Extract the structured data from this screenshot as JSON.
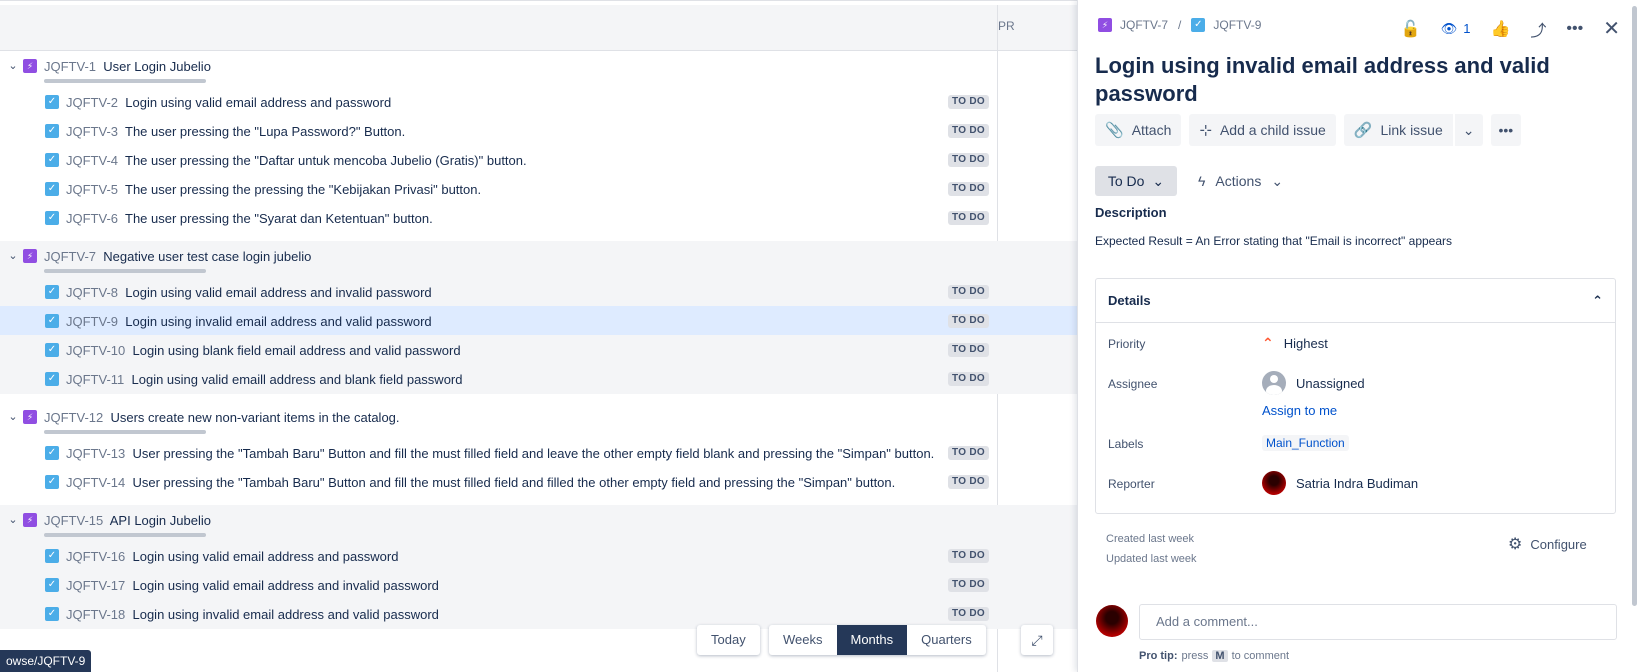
{
  "list": {
    "column_label": "PR",
    "groups": [
      {
        "epic_key": "JQFTV-1",
        "epic_summary": "User Login Jubelio",
        "issues": [
          {
            "key": "JQFTV-2",
            "summary": "Login using valid email address and password",
            "status": "TO DO"
          },
          {
            "key": "JQFTV-3",
            "summary": "The user pressing the \"Lupa Password?\" Button.",
            "status": "TO DO"
          },
          {
            "key": "JQFTV-4",
            "summary": "The user pressing the \"Daftar untuk mencoba Jubelio (Gratis)\" button.",
            "status": "TO DO"
          },
          {
            "key": "JQFTV-5",
            "summary": "The user pressing the pressing the \"Kebijakan Privasi\" button.",
            "status": "TO DO"
          },
          {
            "key": "JQFTV-6",
            "summary": "The user pressing the \"Syarat dan Ketentuan\" button.",
            "status": "TO DO"
          }
        ]
      },
      {
        "epic_key": "JQFTV-7",
        "epic_summary": "Negative user test case login jubelio",
        "issues": [
          {
            "key": "JQFTV-8",
            "summary": "Login using valid email address and invalid password",
            "status": "TO DO"
          },
          {
            "key": "JQFTV-9",
            "summary": "Login using invalid email address and valid password",
            "status": "TO DO"
          },
          {
            "key": "JQFTV-10",
            "summary": "Login using blank field email address and valid password",
            "status": "TO DO"
          },
          {
            "key": "JQFTV-11",
            "summary": "Login using valid emaill address and blank field password",
            "status": "TO DO"
          }
        ]
      },
      {
        "epic_key": "JQFTV-12",
        "epic_summary": "Users create new non-variant items in the catalog.",
        "issues": [
          {
            "key": "JQFTV-13",
            "summary": "User pressing the \"Tambah Baru\" Button and fill the must filled field and leave the other empty field blank and pressing the \"Simpan\" button.",
            "status": "TO DO"
          },
          {
            "key": "JQFTV-14",
            "summary": "User pressing the \"Tambah Baru\" Button and fill the must filled field and filled the other empty field and pressing the \"Simpan\" button.",
            "status": "TO DO"
          }
        ]
      },
      {
        "epic_key": "JQFTV-15",
        "epic_summary": "API Login Jubelio",
        "issues": [
          {
            "key": "JQFTV-16",
            "summary": "Login using valid email address and password",
            "status": "TO DO"
          },
          {
            "key": "JQFTV-17",
            "summary": "Login using valid email address and invalid password",
            "status": "TO DO"
          },
          {
            "key": "JQFTV-18",
            "summary": "Login using invalid email address and valid password",
            "status": "TO DO"
          }
        ]
      }
    ]
  },
  "controls": {
    "today": "Today",
    "weeks": "Weeks",
    "months": "Months",
    "quarters": "Quarters"
  },
  "tooltip": "owse/JQFTV-9",
  "panel": {
    "breadcrumb_parent": "JQFTV-7",
    "breadcrumb_sep": "/",
    "breadcrumb_current": "JQFTV-9",
    "watch_count": "1",
    "title": "Login using invalid email address and valid password",
    "buttons": {
      "attach": "Attach",
      "child_issue": "Add a child issue",
      "link_issue": "Link issue"
    },
    "status": "To Do",
    "actions": "Actions",
    "description_label": "Description",
    "description_text": "Expected Result =  An Error stating that \"Email is incorrect\" appears",
    "details": {
      "heading": "Details",
      "priority_label": "Priority",
      "priority_value": "Highest",
      "assignee_label": "Assignee",
      "assignee_value": "Unassigned",
      "assign_to_me": "Assign to me",
      "labels_label": "Labels",
      "labels_value": "Main_Function",
      "reporter_label": "Reporter",
      "reporter_value": "Satria Indra Budiman"
    },
    "created": "Created last week",
    "updated": "Updated last week",
    "configure": "Configure",
    "comment_placeholder": "Add a comment...",
    "protip_prefix": "Pro tip:",
    "protip_press": "press",
    "protip_key": "M",
    "protip_suffix": "to comment"
  },
  "colors": {
    "epic": "#904ee2",
    "subtask": "#4bade8",
    "selected_row": "#deebff",
    "link": "#0052cc",
    "priority_highest": "#ff5630"
  }
}
